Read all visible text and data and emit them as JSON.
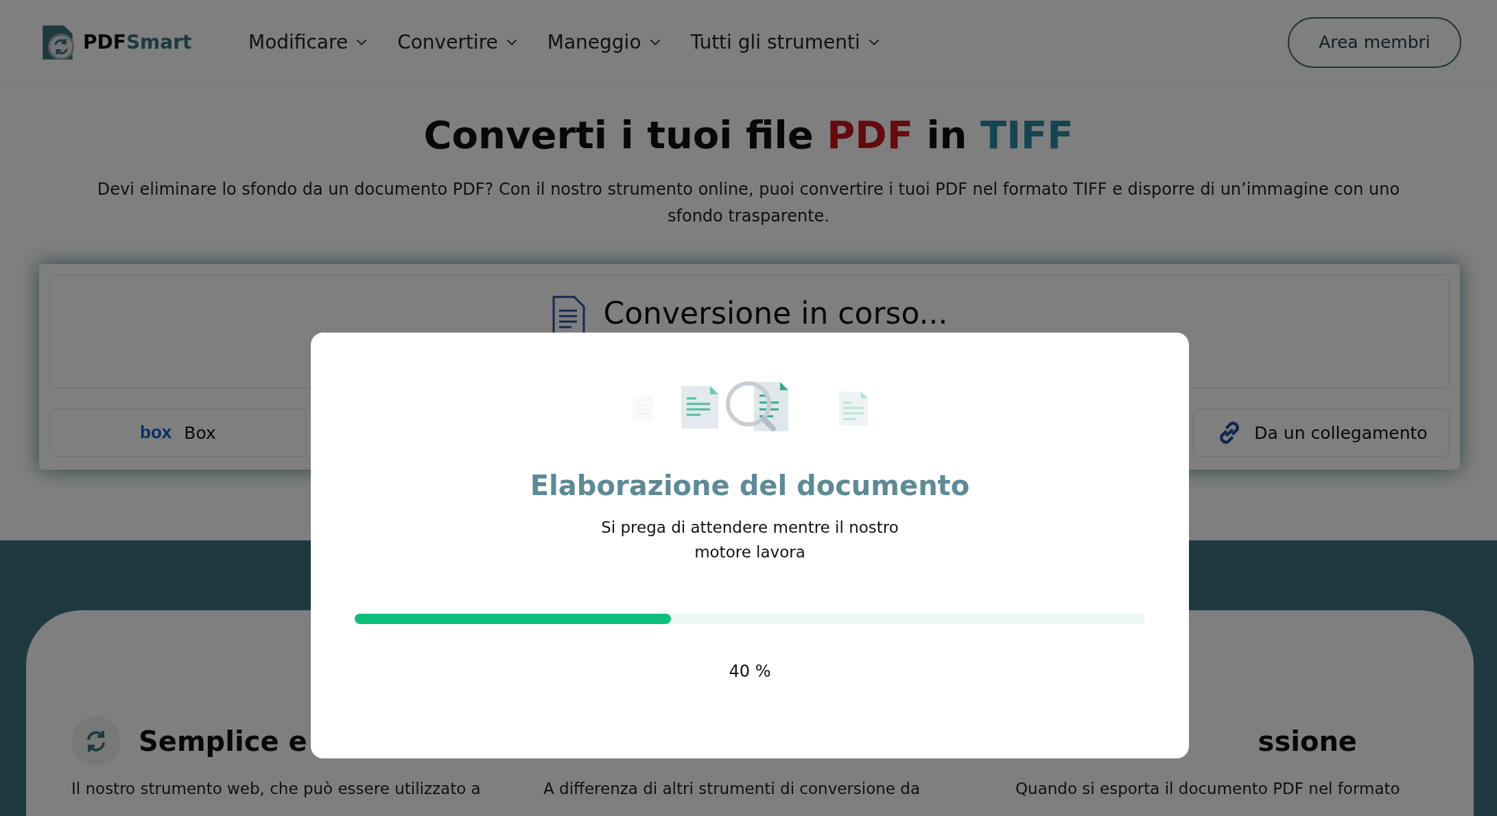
{
  "header": {
    "logo": {
      "part_1": "PDF",
      "part_2": "Smart"
    },
    "nav": [
      {
        "label": "Modificare"
      },
      {
        "label": "Convertire"
      },
      {
        "label": "Maneggio"
      },
      {
        "label": "Tutti gli strumenti"
      }
    ],
    "member_button": "Area membri"
  },
  "hero": {
    "title": [
      {
        "text": "Converti i tuoi file ",
        "kind": "plain"
      },
      {
        "text": "PDF",
        "kind": "pdf"
      },
      {
        "text": " in ",
        "kind": "plain"
      },
      {
        "text": "TIFF",
        "kind": "tiff"
      }
    ],
    "subtitle": "Devi eliminare lo sfondo da un documento PDF? Con il nostro strumento online, puoi convertire i tuoi PDF nel formato TIFF e disporre di un’immagine con uno sfondo trasparente."
  },
  "upload": {
    "status": "Conversione in corso...",
    "sources": [
      {
        "label": "Box",
        "kind": "box"
      },
      {
        "label": "Da un collegamento",
        "kind": "link"
      }
    ]
  },
  "features": [
    {
      "title": "Semplice e",
      "text": "Il nostro strumento web, che può essere utilizzato a",
      "kind": "sync"
    },
    {
      "text": "A differenza di altri strumenti di conversione da",
      "kind": "none"
    },
    {
      "title": "ssione",
      "text": "Quando si esporta il documento PDF nel formato",
      "kind": "none"
    }
  ],
  "modal": {
    "title": "Elaborazione del documento",
    "message": "Si prega di attendere mentre il nostro motore lavora",
    "progress": {
      "level": 0.4,
      "reading": "40 %"
    }
  }
}
